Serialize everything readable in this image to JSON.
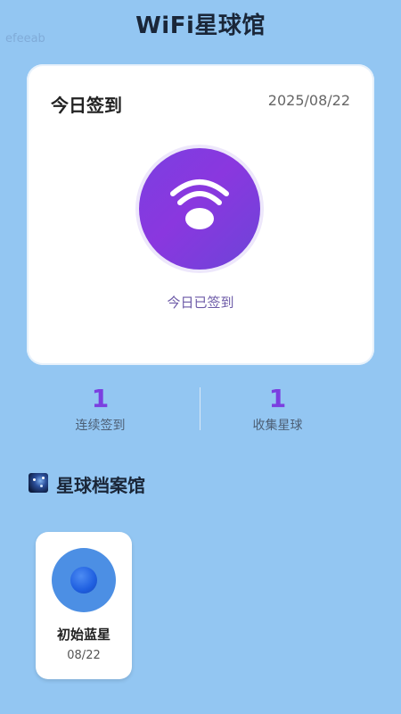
{
  "app": {
    "title": "WiFi星球馆",
    "watermark": "efeeab"
  },
  "checkin": {
    "title": "今日签到",
    "date": "2025/08/22",
    "status": "今日已签到",
    "icon": "wifi-icon",
    "accent": "#7b3fe0"
  },
  "stats": [
    {
      "value": "1",
      "label": "连续签到"
    },
    {
      "value": "1",
      "label": "收集星球"
    }
  ],
  "archive": {
    "title": "星球档案馆",
    "icon": "galaxy-icon",
    "planets": [
      {
        "name": "初始蓝星",
        "date": "08/22",
        "color": "#4c8fe4"
      }
    ]
  }
}
